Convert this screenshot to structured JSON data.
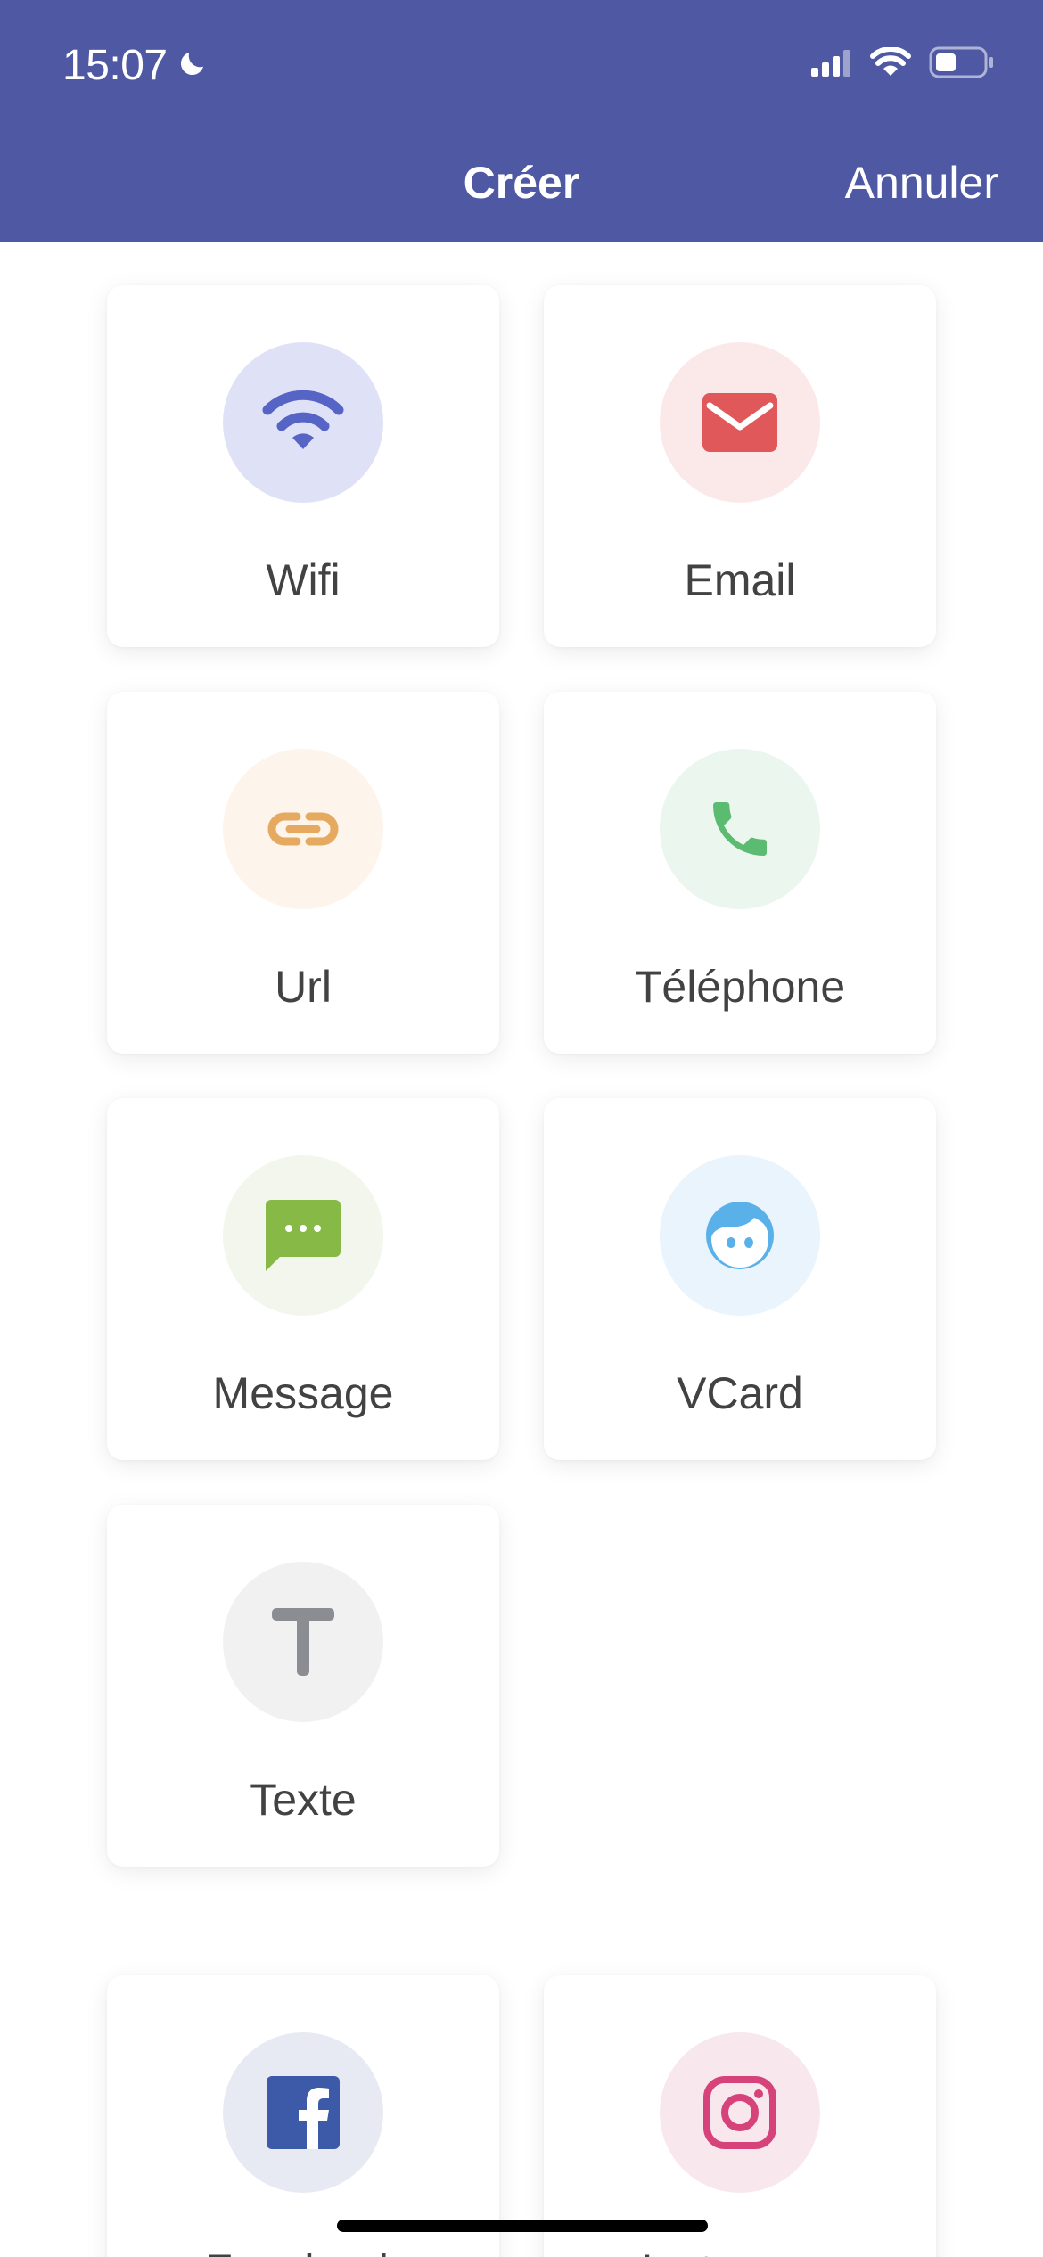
{
  "status_bar": {
    "time": "15:07"
  },
  "nav": {
    "title": "Créer",
    "cancel_label": "Annuler"
  },
  "items": [
    {
      "label": "Wifi",
      "icon": "wifi-icon",
      "bg": "#dfe1f7",
      "color": "#5664c6"
    },
    {
      "label": "Email",
      "icon": "envelope-icon",
      "bg": "#fbe9ea",
      "color": "#e0585a"
    },
    {
      "label": "Url",
      "icon": "link-icon",
      "bg": "#fdf4ec",
      "color": "#e6a960"
    },
    {
      "label": "Téléphone",
      "icon": "phone-icon",
      "bg": "#ebf6ee",
      "color": "#5bbb71"
    },
    {
      "label": "Message",
      "icon": "message-icon",
      "bg": "#f2f6ec",
      "color": "#86b946"
    },
    {
      "label": "VCard",
      "icon": "face-icon",
      "bg": "#eaf4fc",
      "color": "#5ab1ea"
    },
    {
      "label": "Texte",
      "icon": "text-icon",
      "bg": "#f1f1f2",
      "color": "#8b8d92"
    }
  ],
  "social_items": [
    {
      "label": "Facebook",
      "icon": "facebook-icon",
      "bg": "#e8eaf3",
      "color": "#3c5aa8"
    },
    {
      "label": "Instagram",
      "icon": "instagram-icon",
      "bg": "#f8e8ee",
      "color": "#d6437b"
    }
  ]
}
